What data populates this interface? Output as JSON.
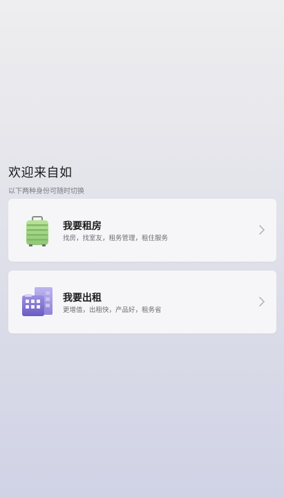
{
  "welcome": {
    "title": "欢迎来自如",
    "subtitle": "以下两种身份可随时切换"
  },
  "options": [
    {
      "title": "我要租房",
      "desc": "找房，找室友，租务管理，租住服务",
      "icon": "suitcase-icon"
    },
    {
      "title": "我要出租",
      "desc": "更增值，出租快，产品好，租务省",
      "icon": "building-icon"
    }
  ],
  "colors": {
    "suitcase_green": "#a9d98a",
    "building_purple": "#8b7fd4"
  }
}
